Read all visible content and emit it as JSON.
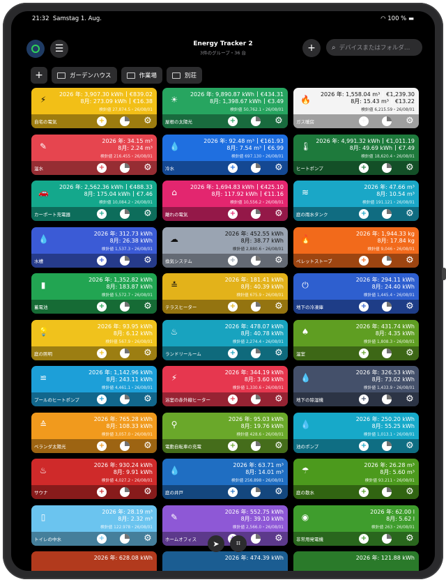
{
  "status": {
    "time": "21:32",
    "date": "Samstag 1. Aug.",
    "battery": "100 %"
  },
  "nav": {
    "title": "Energy Tracker 2",
    "subtitle": "3件のグループ・36 台",
    "search_placeholder": "デバイスまたはフォルダ…",
    "add_label": "+"
  },
  "toolbar": {
    "add_label": "+",
    "folders": [
      "ガーデンハウス",
      "作業場",
      "別荘"
    ]
  },
  "actions": {
    "add": "+",
    "gear": "⚙"
  },
  "cards": [
    {
      "name": "自宅の電気",
      "icon": "⚡",
      "color": "#f2bf17",
      "icolor": "#111",
      "year": "2026 年:",
      "ytotal": "3,907.30 kWh",
      "ycost": "€839.02",
      "month": "8月:",
      "mtotal": "273.09 kWh",
      "mcost": "€16.38",
      "meter": "検針値 27,874.5・26/08/01"
    },
    {
      "name": "屋根の太陽光",
      "icon": "☀",
      "color": "#27a560",
      "year": "2026 年:",
      "ytotal": "9,890.87 kWh",
      "ycost": "€434.31",
      "month": "8月:",
      "mtotal": "1,398.67 kWh",
      "mcost": "€3.49",
      "meter": "検針値 50,762.1・26/08/01"
    },
    {
      "name": "ガス暖房",
      "icon": "🔥",
      "color": "#f4f4f4",
      "textcolor": "#111",
      "icolor": "#111",
      "year": "2026 年:",
      "ytotal": "1,558.04 m³",
      "ycost": "€1,239.30",
      "month": "8月:",
      "mtotal": "15.43 m³",
      "mcost": "€13.22",
      "meter": "検針値 6,215.59・26/08/01"
    },
    {
      "name": "温水",
      "icon": "✎",
      "color": "#e6454f",
      "year": "2026 年:",
      "ytotal": "34.15 m³",
      "ycost": "",
      "month": "8月:",
      "mtotal": "2.24 m³",
      "mcost": "",
      "meter": "検針値 216.455・26/08/01"
    },
    {
      "name": "冷水",
      "icon": "💧",
      "color": "#1f6fe0",
      "year": "2026 年:",
      "ytotal": "92.48 m³",
      "ycost": "€161.93",
      "month": "8月:",
      "mtotal": "7.54 m³",
      "mcost": "€6.99",
      "meter": "検針値 697.130・26/08/01"
    },
    {
      "name": "ヒートポンプ",
      "icon": "🌡",
      "color": "#1e7a3c",
      "year": "2026 年:",
      "ytotal": "4,991.32 kWh",
      "ycost": "€1,011.19",
      "month": "8月:",
      "mtotal": "49.69 kWh",
      "mcost": "€7.49",
      "meter": "検針値 18,620.4・26/08/01"
    },
    {
      "name": "カーポート充電器",
      "icon": "🚗",
      "color": "#14a88c",
      "year": "2026 年:",
      "ytotal": "2,562.36 kWh",
      "ycost": "€488.33",
      "month": "8月:",
      "mtotal": "175.04 kWh",
      "mcost": "€7.46",
      "meter": "検針値 10,084.2・26/08/01"
    },
    {
      "name": "離れの電気",
      "icon": "⌂",
      "color": "#e3266f",
      "year": "2026 年:",
      "ytotal": "1,694.83 kWh",
      "ycost": "€425.10",
      "month": "8月:",
      "mtotal": "117.92 kWh",
      "mcost": "€11.16",
      "meter": "検針値 10,556.2・26/08/01"
    },
    {
      "name": "庭の雨水タンク",
      "icon": "≋",
      "color": "#1aa7c7",
      "year": "2026 年:",
      "ytotal": "47.66 m³",
      "ycost": "",
      "month": "8月:",
      "mtotal": "10.54 m³",
      "mcost": "",
      "meter": "検針値 191.121・26/08/01"
    },
    {
      "name": "水槽",
      "icon": "💧",
      "color": "#3b5bd6",
      "year": "2026 年:",
      "ytotal": "312.73 kWh",
      "ycost": "",
      "month": "8月:",
      "mtotal": "26.38 kWh",
      "mcost": "",
      "meter": "検針値 1,537.3・26/08/01"
    },
    {
      "name": "換気システム",
      "icon": "☁",
      "color": "#9aa4b2",
      "textcolor": "#111",
      "icolor": "#111",
      "year": "2026 年:",
      "ytotal": "452.55 kWh",
      "ycost": "",
      "month": "8月:",
      "mtotal": "38.77 kWh",
      "mcost": "",
      "meter": "検針値 2,880.6・26/08/01"
    },
    {
      "name": "ペレットストーブ",
      "icon": "🔥",
      "color": "#f26a1b",
      "year": "2026 年:",
      "ytotal": "1,944.33 kg",
      "ycost": "",
      "month": "8月:",
      "mtotal": "17.84 kg",
      "mcost": "",
      "meter": "検針値 9,046・26/08/01"
    },
    {
      "name": "蓄電池",
      "icon": "▮",
      "color": "#22a552",
      "year": "2026 年:",
      "ytotal": "1,352.82 kWh",
      "ycost": "",
      "month": "8月:",
      "mtotal": "183.87 kWh",
      "mcost": "",
      "meter": "検針値 5,572.7・26/08/01"
    },
    {
      "name": "テラスヒーター",
      "icon": "≛",
      "color": "#e3b21a",
      "icolor": "#111",
      "year": "2026 年:",
      "ytotal": "181.41 kWh",
      "ycost": "",
      "month": "8月:",
      "mtotal": "40.39 kWh",
      "mcost": "",
      "meter": "検針値 675.9・26/08/01"
    },
    {
      "name": "地下の冷凍庫",
      "icon": "⏻",
      "color": "#2e5fcf",
      "year": "2026 年:",
      "ytotal": "294.11 kWh",
      "ycost": "",
      "month": "8月:",
      "mtotal": "24.40 kWh",
      "mcost": "",
      "meter": "検針値 1,445.4・26/08/01"
    },
    {
      "name": "庭の照明",
      "icon": "💡",
      "color": "#f0c21c",
      "icolor": "#111",
      "year": "2026 年:",
      "ytotal": "93.95 kWh",
      "ycost": "",
      "month": "8月:",
      "mtotal": "6.12 kWh",
      "mcost": "",
      "meter": "検針値 567.9・26/08/01"
    },
    {
      "name": "ランドリールーム",
      "icon": "♨",
      "color": "#18a3bf",
      "year": "2026 年:",
      "ytotal": "478.07 kWh",
      "ycost": "",
      "month": "8月:",
      "mtotal": "40.78 kWh",
      "mcost": "",
      "meter": "検針値 2,274.4・26/08/01"
    },
    {
      "name": "温室",
      "icon": "♠",
      "color": "#5f9e22",
      "year": "2026 年:",
      "ytotal": "431.74 kWh",
      "ycost": "",
      "month": "8月:",
      "mtotal": "4.35 kWh",
      "mcost": "",
      "meter": "検針値 1,808.3・26/08/01"
    },
    {
      "name": "プールのヒートポンプ",
      "icon": "≌",
      "color": "#1d9fd8",
      "year": "2026 年:",
      "ytotal": "1,142.96 kWh",
      "ycost": "",
      "month": "8月:",
      "mtotal": "243.11 kWh",
      "mcost": "",
      "meter": "検針値 4,461.1・26/08/01"
    },
    {
      "name": "浴室の赤外線ヒーター",
      "icon": "⚡",
      "color": "#e6374f",
      "year": "2026 年:",
      "ytotal": "344.19 kWh",
      "ycost": "",
      "month": "8月:",
      "mtotal": "3.60 kWh",
      "mcost": "",
      "meter": "検針値 1,330.6・26/08/01"
    },
    {
      "name": "地下の除湿機",
      "icon": "💧",
      "color": "#44506a",
      "year": "2026 年:",
      "ytotal": "326.53 kWh",
      "ycost": "",
      "month": "8月:",
      "mtotal": "73.02 kWh",
      "mcost": "",
      "meter": "検針値 1,433.9・26/08/01"
    },
    {
      "name": "ベランダ太陽光",
      "icon": "≙",
      "color": "#f19a1d",
      "year": "2026 年:",
      "ytotal": "765.28 kWh",
      "ycost": "",
      "month": "8月:",
      "mtotal": "108.33 kWh",
      "mcost": "",
      "meter": "検針値 3,057.0・26/08/01"
    },
    {
      "name": "電動自転車の充電",
      "icon": "⚲",
      "color": "#6aa82a",
      "year": "2026 年:",
      "ytotal": "95.03 kWh",
      "ycost": "",
      "month": "8月:",
      "mtotal": "19.76 kWh",
      "mcost": "",
      "meter": "検針値 428.6・26/08/01"
    },
    {
      "name": "池のポンプ",
      "icon": "💧",
      "color": "#17a9c9",
      "year": "2026 年:",
      "ytotal": "250.20 kWh",
      "ycost": "",
      "month": "8月:",
      "mtotal": "55.25 kWh",
      "mcost": "",
      "meter": "検針値 1,013.1・26/08/01"
    },
    {
      "name": "サウナ",
      "icon": "♨",
      "color": "#cf2a2a",
      "year": "2026 年:",
      "ytotal": "930.24 kWh",
      "ycost": "",
      "month": "8月:",
      "mtotal": "9.91 kWh",
      "mcost": "",
      "meter": "検針値 4,027.2・26/08/01"
    },
    {
      "name": "庭の井戸",
      "icon": "💧",
      "color": "#1f6ec2",
      "year": "2026 年:",
      "ytotal": "63.71 m³",
      "ycost": "",
      "month": "8月:",
      "mtotal": "14.01 m³",
      "mcost": "",
      "meter": "検針値 256.898・26/08/01"
    },
    {
      "name": "庭の散水",
      "icon": "☂",
      "color": "#4c9a1d",
      "year": "2026 年:",
      "ytotal": "26.28 m³",
      "ycost": "",
      "month": "8月:",
      "mtotal": "5.60 m³",
      "mcost": "",
      "meter": "検針値 93.211・26/08/01"
    },
    {
      "name": "トイレの中水",
      "icon": "▯",
      "color": "#6bc4ef",
      "year": "2026 年:",
      "ytotal": "28.19 m³",
      "ycost": "",
      "month": "8月:",
      "mtotal": "2.32 m³",
      "mcost": "",
      "meter": "検針値 122.978・26/08/01"
    },
    {
      "name": "ホームオフィス",
      "icon": "✎",
      "color": "#8e58d6",
      "year": "2026 年:",
      "ytotal": "552.75 kWh",
      "ycost": "",
      "month": "8月:",
      "mtotal": "39.10 kWh",
      "mcost": "",
      "meter": "検針値 2,566.0・26/08/01"
    },
    {
      "name": "非常用発電機",
      "icon": "◉",
      "color": "#3f9d2d",
      "year": "2026 年:",
      "ytotal": "62.00 l",
      "ycost": "",
      "month": "8月:",
      "mtotal": "5.62 l",
      "mcost": "",
      "meter": "検針値 263・26/08/01"
    },
    {
      "name": "",
      "icon": "",
      "color": "#b23a1d",
      "year": "2026 年:",
      "ytotal": "628.08 kWh",
      "ycost": "",
      "month": "",
      "mtotal": "",
      "mcost": "",
      "meter": ""
    },
    {
      "name": "",
      "icon": "",
      "color": "#1b5d92",
      "year": "2026 年:",
      "ytotal": "474.39 kWh",
      "ycost": "",
      "month": "",
      "mtotal": "",
      "mcost": "",
      "meter": ""
    },
    {
      "name": "",
      "icon": "",
      "color": "#2a7a2a",
      "year": "2026 年:",
      "ytotal": "121.88 kWh",
      "ycost": "",
      "month": "",
      "mtotal": "",
      "mcost": "",
      "meter": ""
    }
  ],
  "bottom": {
    "locate_icon": "➤",
    "scan_icon": "⌗"
  }
}
